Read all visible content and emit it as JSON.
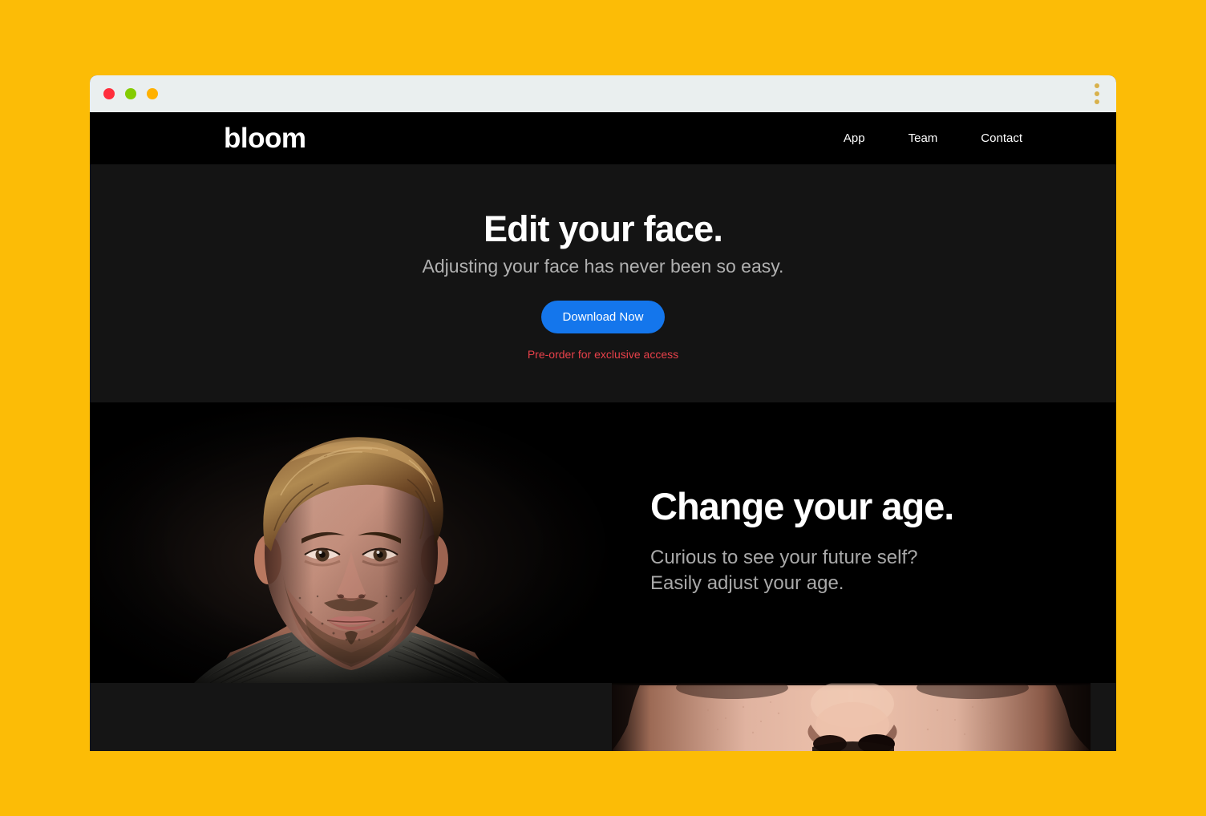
{
  "page": {
    "background_color": "#FCBC06"
  },
  "browser": {
    "titlebar_color": "#EAEFEF",
    "traffic_lights": [
      {
        "name": "close",
        "color": "#FF2E3C"
      },
      {
        "name": "minimize",
        "color": "#84CC00"
      },
      {
        "name": "maximize",
        "color": "#FFB100"
      }
    ],
    "menu_icon": "kebab-menu-icon"
  },
  "nav": {
    "brand": "bloom",
    "links": [
      {
        "label": "App"
      },
      {
        "label": "Team"
      },
      {
        "label": "Contact"
      }
    ]
  },
  "hero": {
    "title": "Edit your face.",
    "subtitle": "Adjusting your face has never been so easy.",
    "cta_label": "Download Now",
    "cta_color": "#1476EC",
    "preorder_note": "Pre-order for exclusive access",
    "preorder_color": "#E8414A",
    "background_color": "#141414"
  },
  "age_section": {
    "title": "Change your age.",
    "subtitle": "Curious to see your future self?\nEasily adjust your age.",
    "image_alt": "portrait-of-man-with-wavy-brown-hair-and-stubble",
    "background_color": "#000000"
  },
  "bottom_strip": {
    "image_alt": "closeup-of-nose-and-cheeks",
    "background_color": "#151515"
  }
}
